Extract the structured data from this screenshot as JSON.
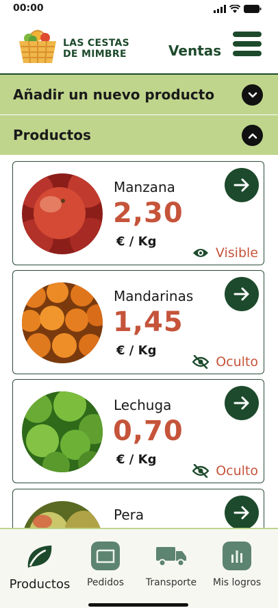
{
  "status_bar": {
    "time": "00:00"
  },
  "header": {
    "brand_line1": "LAS CESTAS",
    "brand_line2": "DE MIMBRE",
    "section": "Ventas"
  },
  "accordions": {
    "add_product": "Añadir un nuevo producto",
    "products": "Productos"
  },
  "products": [
    {
      "name": "Manzana",
      "price": "2,30",
      "unit": "€ / Kg",
      "visibility": "Visible"
    },
    {
      "name": "Mandarinas",
      "price": "1,45",
      "unit": "€ / Kg",
      "visibility": "Oculto"
    },
    {
      "name": "Lechuga",
      "price": "0,70",
      "unit": "€ / Kg",
      "visibility": "Oculto"
    },
    {
      "name": "Pera"
    }
  ],
  "tabs": [
    {
      "label": "Productos",
      "icon": "leaf-icon",
      "active": true
    },
    {
      "label": "Pedidos",
      "icon": "folder-icon"
    },
    {
      "label": "Transporte",
      "icon": "truck-icon"
    },
    {
      "label": "Mis logros",
      "icon": "chart-icon"
    }
  ],
  "colors": {
    "primary": "#1d4a2c",
    "accent": "#c5543a",
    "section_bg": "#bfd58c"
  }
}
